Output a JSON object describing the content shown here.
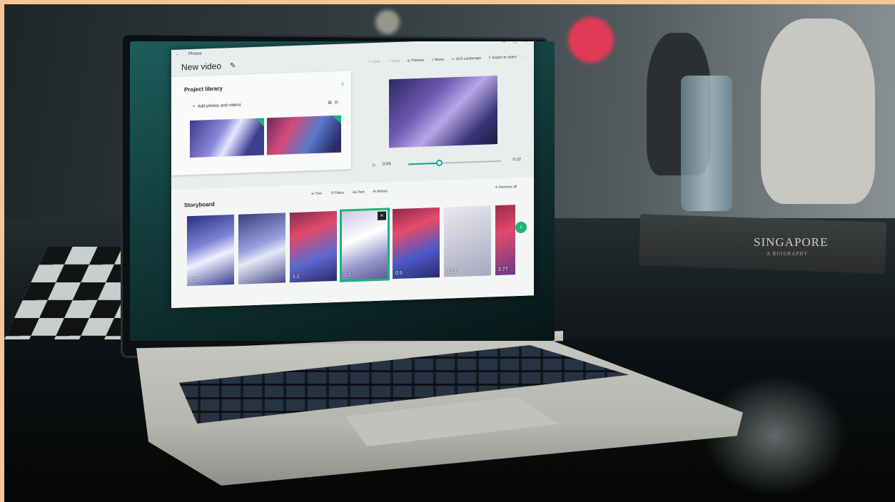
{
  "scene": {
    "book_title": "SINGAPORE",
    "book_subtitle": "A BIOGRAPHY"
  },
  "app": {
    "window_title": "Photos",
    "back_glyph": "←",
    "window_controls": [
      "–",
      "□",
      "×"
    ],
    "project_title": "New video",
    "edit_icon": "pencil-icon",
    "toolbar": {
      "undo": "Undo",
      "redo": "Redo",
      "themes": "Themes",
      "music": "Music",
      "aspect": "16:9 Landscape",
      "export": "Export or share",
      "more": "..."
    },
    "library": {
      "title": "Project library",
      "add_label": "Add photos and videos",
      "accent": "#1cb37a"
    },
    "player": {
      "current_time": "0:04",
      "total_time": "0:12",
      "progress": 0.33
    },
    "storyboard": {
      "title": "Storyboard",
      "tools": [
        "Trim",
        "Filters",
        "Text",
        "Motion"
      ],
      "remove_all": "Remove all",
      "clips": [
        {
          "duration": "2.23",
          "selected": false
        },
        {
          "duration": "",
          "selected": false
        },
        {
          "duration": "1.1",
          "selected": false
        },
        {
          "duration": "1.1",
          "selected": true
        },
        {
          "duration": "0.5",
          "selected": false
        },
        {
          "duration": "1.13",
          "selected": false
        },
        {
          "duration": "2.77",
          "selected": false
        }
      ]
    }
  }
}
